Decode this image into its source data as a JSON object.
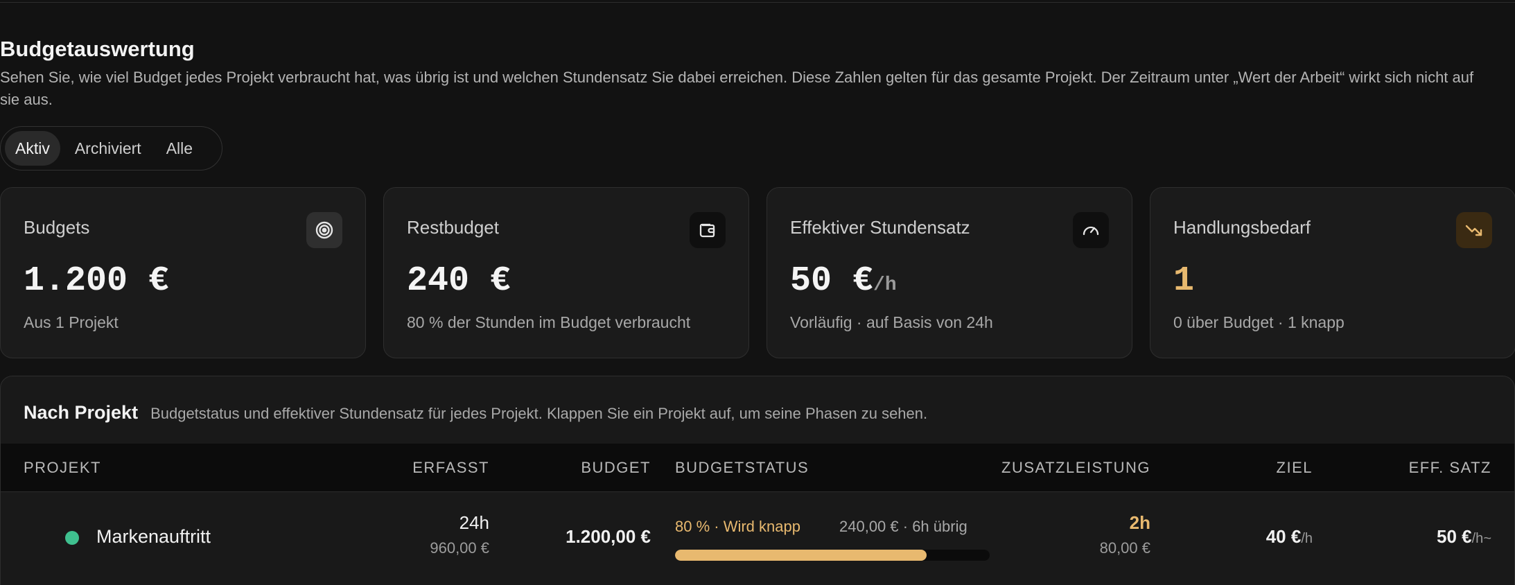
{
  "header": {
    "title": "Budgetauswertung",
    "description": "Sehen Sie, wie viel Budget jedes Projekt verbraucht hat, was übrig ist und welchen Stundensatz Sie dabei erreichen. Diese Zahlen gelten für das gesamte Projekt. Der Zeitraum unter „Wert der Arbeit“ wirkt sich nicht auf sie aus."
  },
  "tabs": [
    {
      "label": "Aktiv",
      "active": true
    },
    {
      "label": "Archiviert",
      "active": false
    },
    {
      "label": "Alle",
      "active": false
    }
  ],
  "cards": [
    {
      "label": "Budgets",
      "value": "1.200 €",
      "unit": "",
      "sub": "Aus 1 Projekt",
      "icon": "target-icon"
    },
    {
      "label": "Restbudget",
      "value": "240 €",
      "unit": "",
      "sub": "80 % der Stunden im Budget verbraucht",
      "icon": "wallet-icon"
    },
    {
      "label": "Effektiver Stundensatz",
      "value": "50 €",
      "unit": "/h",
      "sub": "Vorläufig · auf Basis von 24h",
      "icon": "gauge-icon"
    },
    {
      "label": "Handlungsbedarf",
      "value": "1",
      "unit": "",
      "sub": "0 über Budget · 1 knapp",
      "icon": "trending-down-icon"
    }
  ],
  "colors": {
    "accent_warn": "#e8b96f",
    "dot_green": "#3fc08f"
  },
  "table": {
    "title": "Nach Projekt",
    "description": "Budgetstatus und effektiver Stundensatz für jedes Projekt. Klappen Sie ein Projekt auf, um seine Phasen zu sehen.",
    "columns": {
      "project": "PROJEKT",
      "recorded": "ERFASST",
      "budget": "BUDGET",
      "status": "BUDGETSTATUS",
      "extra": "ZUSATZLEISTUNG",
      "target": "ZIEL",
      "eff_rate": "EFF. SATZ"
    },
    "rows": [
      {
        "name": "Markenauftritt",
        "recorded_hours": "24h",
        "recorded_value": "960,00 €",
        "budget": "1.200,00 €",
        "status_label": "80 % · Wird knapp",
        "status_remaining": "240,00 € · 6h übrig",
        "progress": 0.8,
        "extra_hours": "2h",
        "extra_value": "80,00 €",
        "target_value": "40 €",
        "target_unit": "/h",
        "eff_value": "50 €",
        "eff_unit": "/h",
        "eff_suffix": "~"
      }
    ]
  }
}
